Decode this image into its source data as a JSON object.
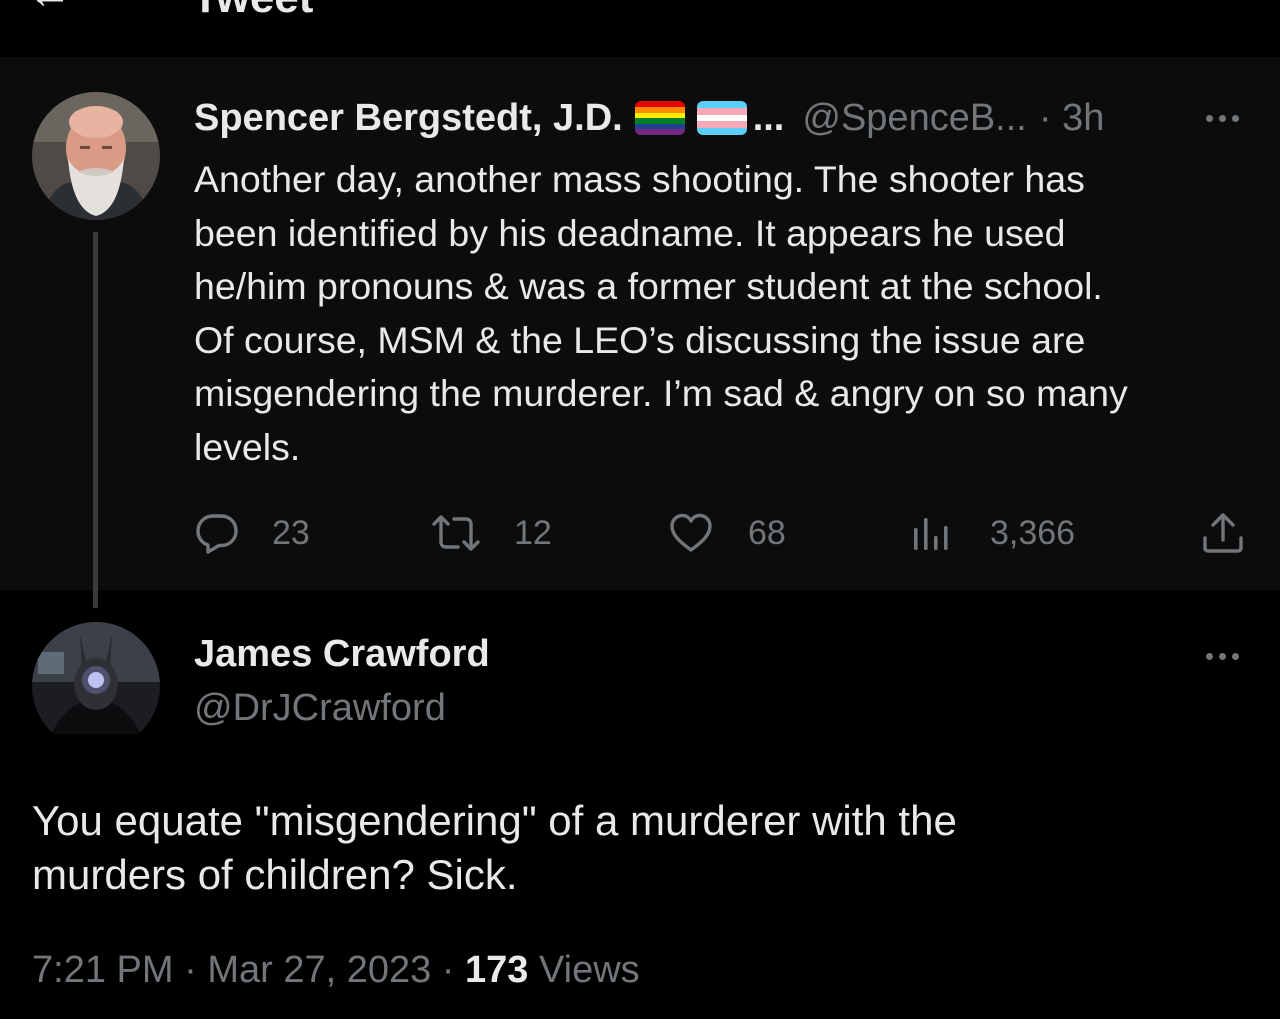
{
  "header": {
    "back_icon": "back-arrow-icon",
    "title": "Tweet"
  },
  "parent_tweet": {
    "avatar_icon": "avatar-bald-bearded-man",
    "display_name": "Spencer Bergstedt, J.D.",
    "flags": [
      "rainbow-pride-flag",
      "transgender-flag"
    ],
    "name_ellipsis": "...",
    "handle": "@SpenceB...",
    "time": "· 3h",
    "text": "Another day, another mass shooting. The shooter has\nbeen identified by his deadname. It appears he used\nhe/him pronouns & was a former student at the school.\nOf course, MSM & the LEO’s discussing the issue are\nmisgendering the murderer. I’m sad & angry on so many\nlevels.",
    "metrics": {
      "replies": "23",
      "retweets": "12",
      "likes": "68",
      "views": "3,366"
    }
  },
  "reply_tweet": {
    "avatar_icon": "avatar-dark-rabbit-mask",
    "display_name": "James Crawford",
    "handle": "@DrJCrawford",
    "text": "You equate \"misgendering\" of a murderer with the\nmurders of children?   Sick.",
    "time": "7:21 PM",
    "sep1": " · ",
    "date": "Mar 27, 2023",
    "sep2": " · ",
    "views_count": "173",
    "views_label": " Views"
  },
  "colors": {
    "background": "#000000",
    "parent_background": "#0c0c0c",
    "text_primary": "#e7e9ea",
    "text_secondary": "#71767b",
    "thread_line": "#3a3a3a"
  }
}
